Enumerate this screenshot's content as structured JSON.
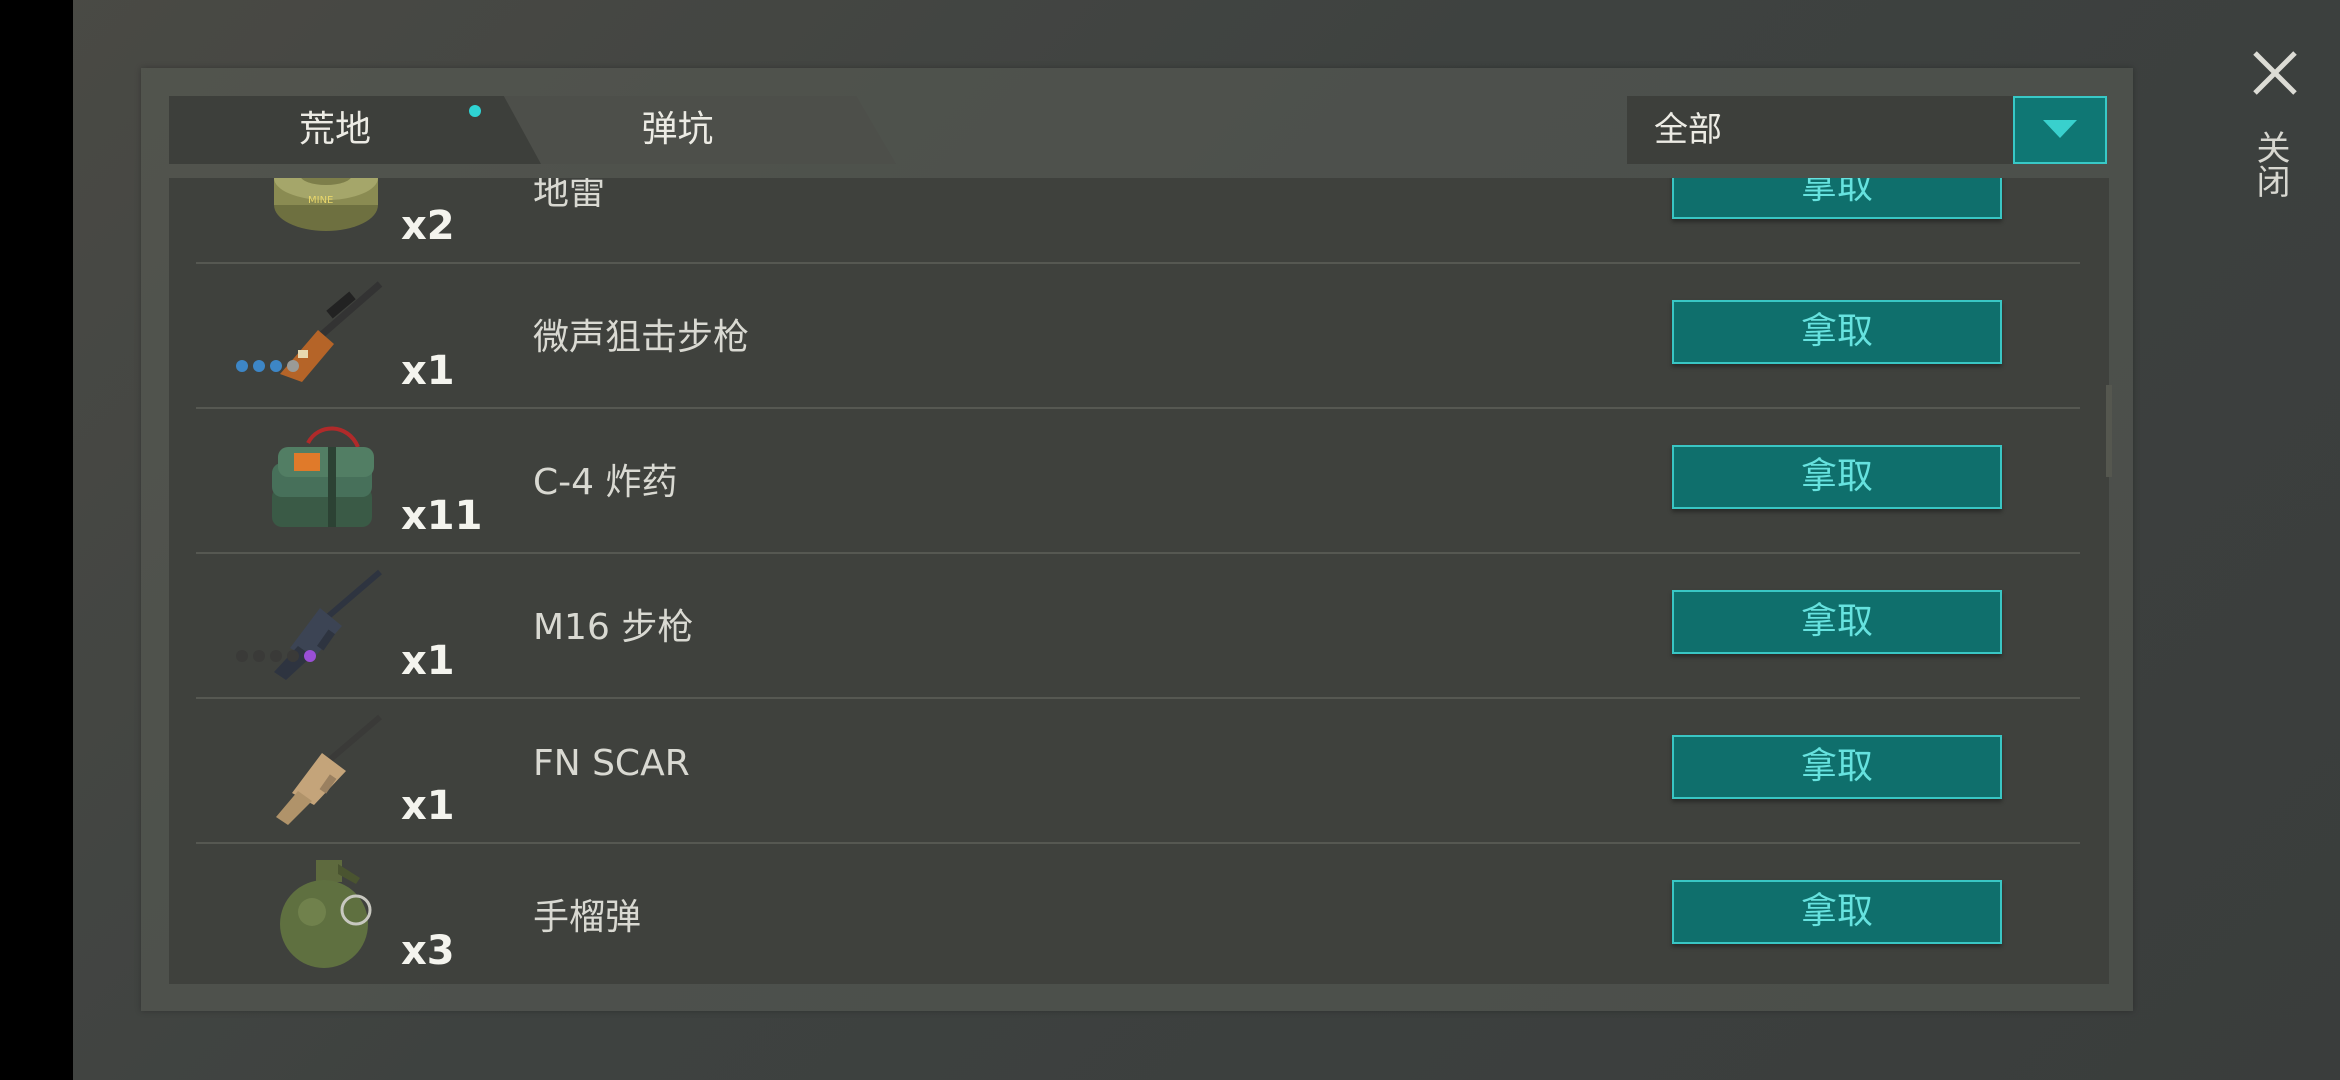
{
  "tabs": [
    {
      "label": "荒地",
      "active": true,
      "has_notification": true
    },
    {
      "label": "弹坑",
      "active": false
    }
  ],
  "filter": {
    "selected": "全部"
  },
  "close": {
    "label": "关闭"
  },
  "items": [
    {
      "name": "地雷",
      "qty": "x2",
      "icon": "landmine-icon",
      "button": "拿取"
    },
    {
      "name": "微声狙击步枪",
      "qty": "x1",
      "icon": "silenced-sniper-rifle-icon",
      "button": "拿取",
      "rarity_dots": [
        "#3d86c6",
        "#3d86c6",
        "#3d86c6",
        "#9a9a96"
      ]
    },
    {
      "name": "C-4 炸药",
      "qty": "x11",
      "icon": "c4-explosive-icon",
      "button": "拿取"
    },
    {
      "name": "M16 步枪",
      "qty": "x1",
      "icon": "m16-rifle-icon",
      "button": "拿取",
      "rarity_dots": [
        "#3a3a38",
        "#3a3a38",
        "#3a3a38",
        "#3a3a38",
        "#9a4fd6"
      ]
    },
    {
      "name": "FN SCAR",
      "qty": "x1",
      "icon": "fn-scar-icon",
      "button": "拿取"
    },
    {
      "name": "手榴弹",
      "qty": "x3",
      "icon": "grenade-icon",
      "button": "拿取"
    }
  ],
  "colors": {
    "accent": "#0f6f6c",
    "accent_border": "#39c6c4",
    "button_text": "#66e2df",
    "notify_dot": "#2fd3d3"
  }
}
